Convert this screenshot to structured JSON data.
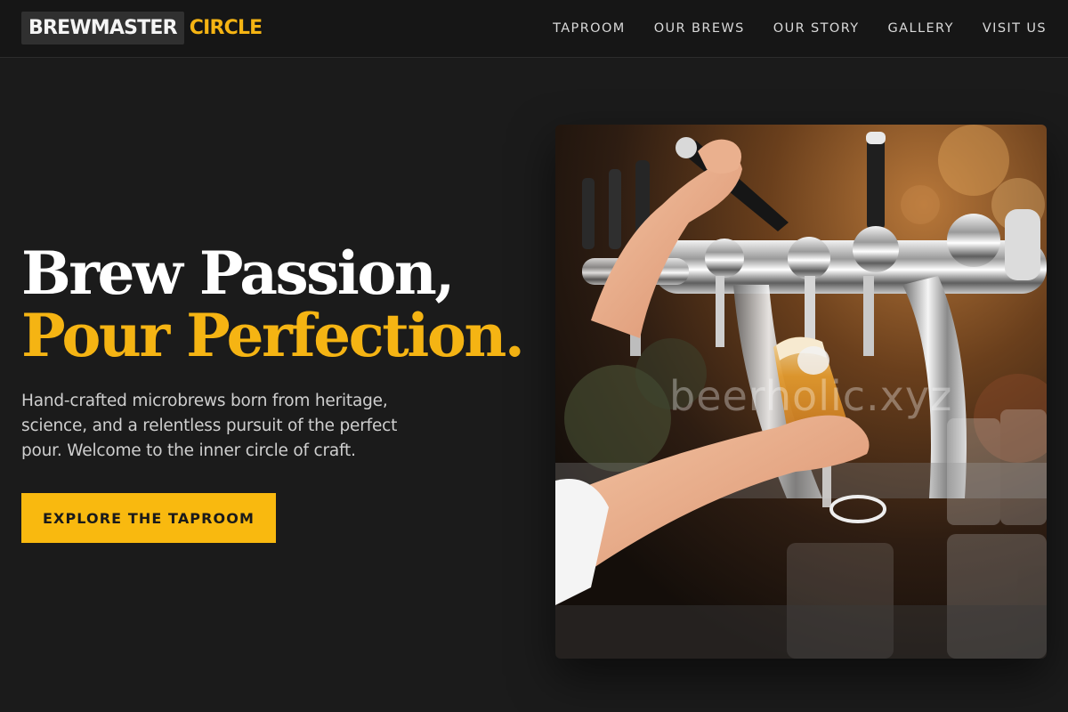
{
  "brand": {
    "name_part1": "BREWMASTER",
    "name_part2": "CIRCLE",
    "accent_color": "#f5b413"
  },
  "nav": {
    "items": [
      {
        "label": "TAPROOM"
      },
      {
        "label": "OUR BREWS"
      },
      {
        "label": "OUR STORY"
      },
      {
        "label": "GALLERY"
      },
      {
        "label": "VISIT US"
      }
    ]
  },
  "hero": {
    "title_line1": "Brew Passion,",
    "title_line2": "Pour Perfection.",
    "subtitle": "Hand-crafted microbrews born from heritage, science, and a relentless pursuit of the perfect pour. Welcome to the inner circle of craft.",
    "cta_label": "EXPLORE THE TAPROOM",
    "image_alt": "Bartender pouring beer from chrome taps",
    "watermark": "beerholic.xyz"
  }
}
